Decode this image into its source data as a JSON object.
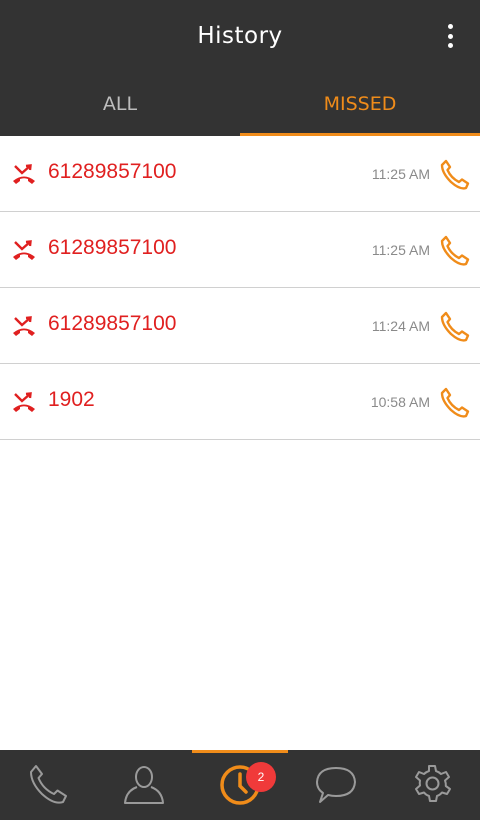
{
  "header": {
    "title": "History",
    "menu_icon": "overflow-menu-icon"
  },
  "tabs": [
    {
      "label": "ALL",
      "active": false
    },
    {
      "label": "MISSED",
      "active": true
    }
  ],
  "calls": [
    {
      "number": "61289857100",
      "time": "11:25 AM",
      "type": "missed"
    },
    {
      "number": "61289857100",
      "time": "11:25 AM",
      "type": "missed"
    },
    {
      "number": "61289857100",
      "time": "11:24 AM",
      "type": "missed"
    },
    {
      "number": "1902",
      "time": "10:58 AM",
      "type": "missed"
    }
  ],
  "bottom_nav": [
    {
      "icon": "phone-icon",
      "active": false
    },
    {
      "icon": "contacts-icon",
      "active": false
    },
    {
      "icon": "history-clock-icon",
      "active": true,
      "badge": "2"
    },
    {
      "icon": "chat-icon",
      "active": false
    },
    {
      "icon": "settings-gear-icon",
      "active": false
    }
  ],
  "colors": {
    "bar": "#333333",
    "accent": "#f08c1a",
    "missed": "#e02020",
    "time": "#8a8a8a",
    "badge": "#f03a3a"
  }
}
